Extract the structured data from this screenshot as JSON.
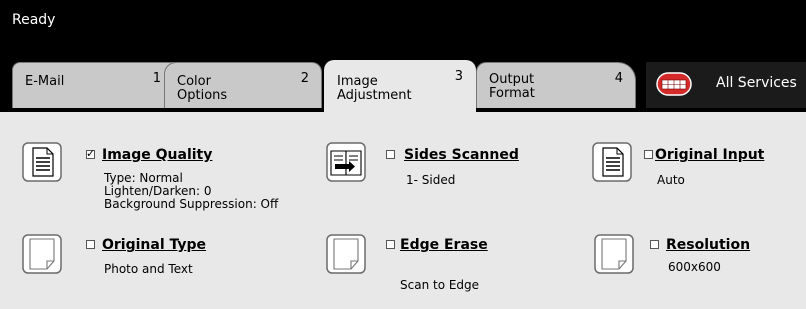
{
  "status": {
    "text": "Ready"
  },
  "tabs": [
    {
      "label_line1": "E-Mail",
      "label_line2": "",
      "number": "1"
    },
    {
      "label_line1": "Color",
      "label_line2": "Options",
      "number": "2"
    },
    {
      "label_line1": "Image",
      "label_line2": "Adjustment",
      "number": "3"
    },
    {
      "label_line1": "Output",
      "label_line2": "Format",
      "number": "4"
    }
  ],
  "all_services": {
    "label": "All Services",
    "icon": "all-services-icon"
  },
  "features": {
    "image_quality": {
      "title": "Image Quality",
      "checked": true,
      "details": [
        "Type: Normal",
        "Lighten/Darken: 0",
        "Background Suppression: Off"
      ],
      "icon": "document-text-icon"
    },
    "sides_scanned": {
      "title": "Sides Scanned",
      "checked": false,
      "details": [
        "1- Sided"
      ],
      "icon": "sides-scanned-icon"
    },
    "original_input": {
      "title": "Original Input",
      "checked": false,
      "details": [
        "Auto"
      ],
      "icon": "document-text-icon"
    },
    "original_type": {
      "title": "Original Type",
      "checked": false,
      "details": [
        "Photo and Text"
      ],
      "icon": "blank-page-icon"
    },
    "edge_erase": {
      "title": "Edge Erase",
      "checked": false,
      "details": [
        "Scan to Edge"
      ],
      "icon": "blank-page-icon"
    },
    "resolution": {
      "title": "Resolution",
      "checked": false,
      "details": [
        "600x600"
      ],
      "icon": "blank-page-icon"
    }
  },
  "colors": {
    "status_bar": "#000000",
    "tab_inactive": "#c9c9c9",
    "tab_active": "#e8e8e8",
    "content_bg": "#e8e8e8",
    "all_services_icon": "#d42a2a"
  }
}
